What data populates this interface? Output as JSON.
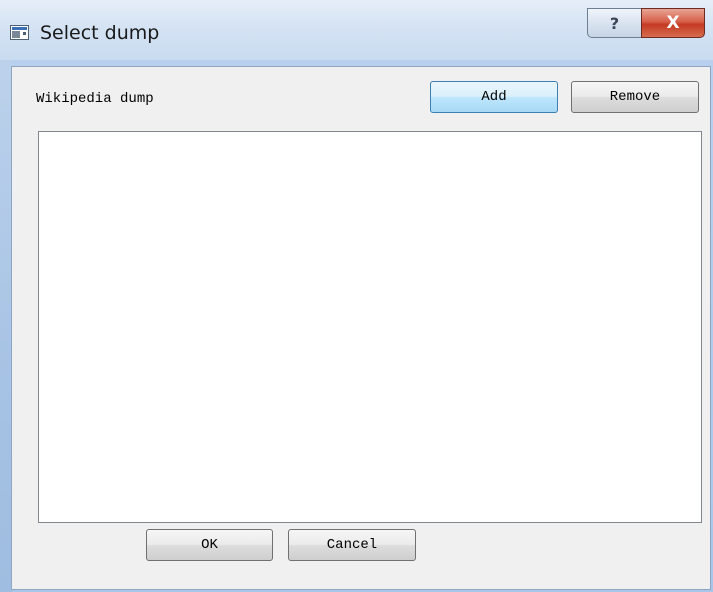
{
  "window": {
    "title": "Select dump",
    "help_glyph": "?",
    "close_glyph": "X",
    "icons": {
      "title_icon": "window-app-icon",
      "help": "help-icon",
      "close": "close-icon"
    }
  },
  "form": {
    "label": "Wikipedia dump",
    "add_label": "Add",
    "remove_label": "Remove",
    "items": []
  },
  "footer": {
    "ok_label": "OK",
    "cancel_label": "Cancel"
  },
  "colors": {
    "close_button": "#c43a22",
    "default_button_border": "#3c7fb1",
    "client_background": "#f0f0f0",
    "list_background": "#ffffff"
  }
}
